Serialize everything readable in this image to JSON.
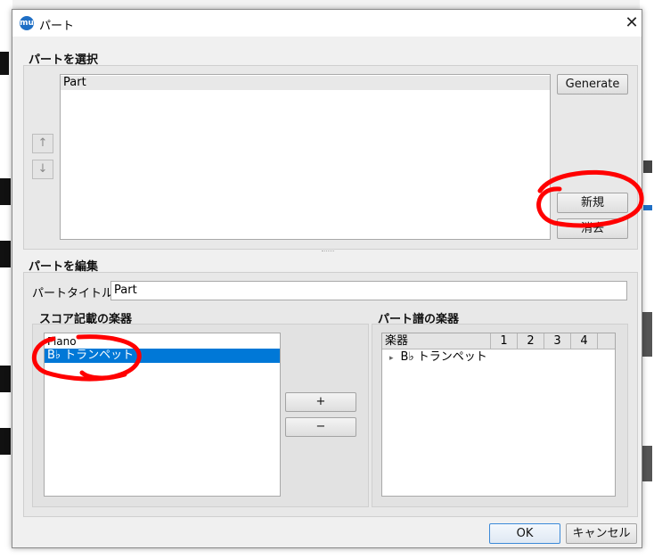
{
  "dialog": {
    "title": "パート",
    "app_icon_text": "mu",
    "close_glyph": "✕"
  },
  "select_parts": {
    "heading": "パートを選択",
    "parts_list": [
      "Part"
    ],
    "move_up_glyph": "↑",
    "move_down_glyph": "↓",
    "generate_label": "Generate",
    "new_label": "新規",
    "delete_label": "消去"
  },
  "edit_part": {
    "heading": "パートを編集",
    "part_title_label": "パートタイトル:",
    "part_title_value": "Part"
  },
  "score_instruments": {
    "heading": "スコア記載の楽器",
    "items": [
      "Piano",
      "B♭ トランペット"
    ],
    "selected_index": 1
  },
  "transfer": {
    "add_label": "+",
    "remove_label": "−"
  },
  "part_instruments": {
    "heading": "パート譜の楽器",
    "columns": [
      "楽器",
      "1",
      "2",
      "3",
      "4"
    ],
    "rows": [
      {
        "expand_glyph": "▸",
        "name": "B♭ トランペット"
      }
    ]
  },
  "footer": {
    "ok_label": "OK",
    "cancel_label": "キャンセル"
  },
  "colors": {
    "selection": "#0078d7",
    "annotation": "#ff0000"
  }
}
